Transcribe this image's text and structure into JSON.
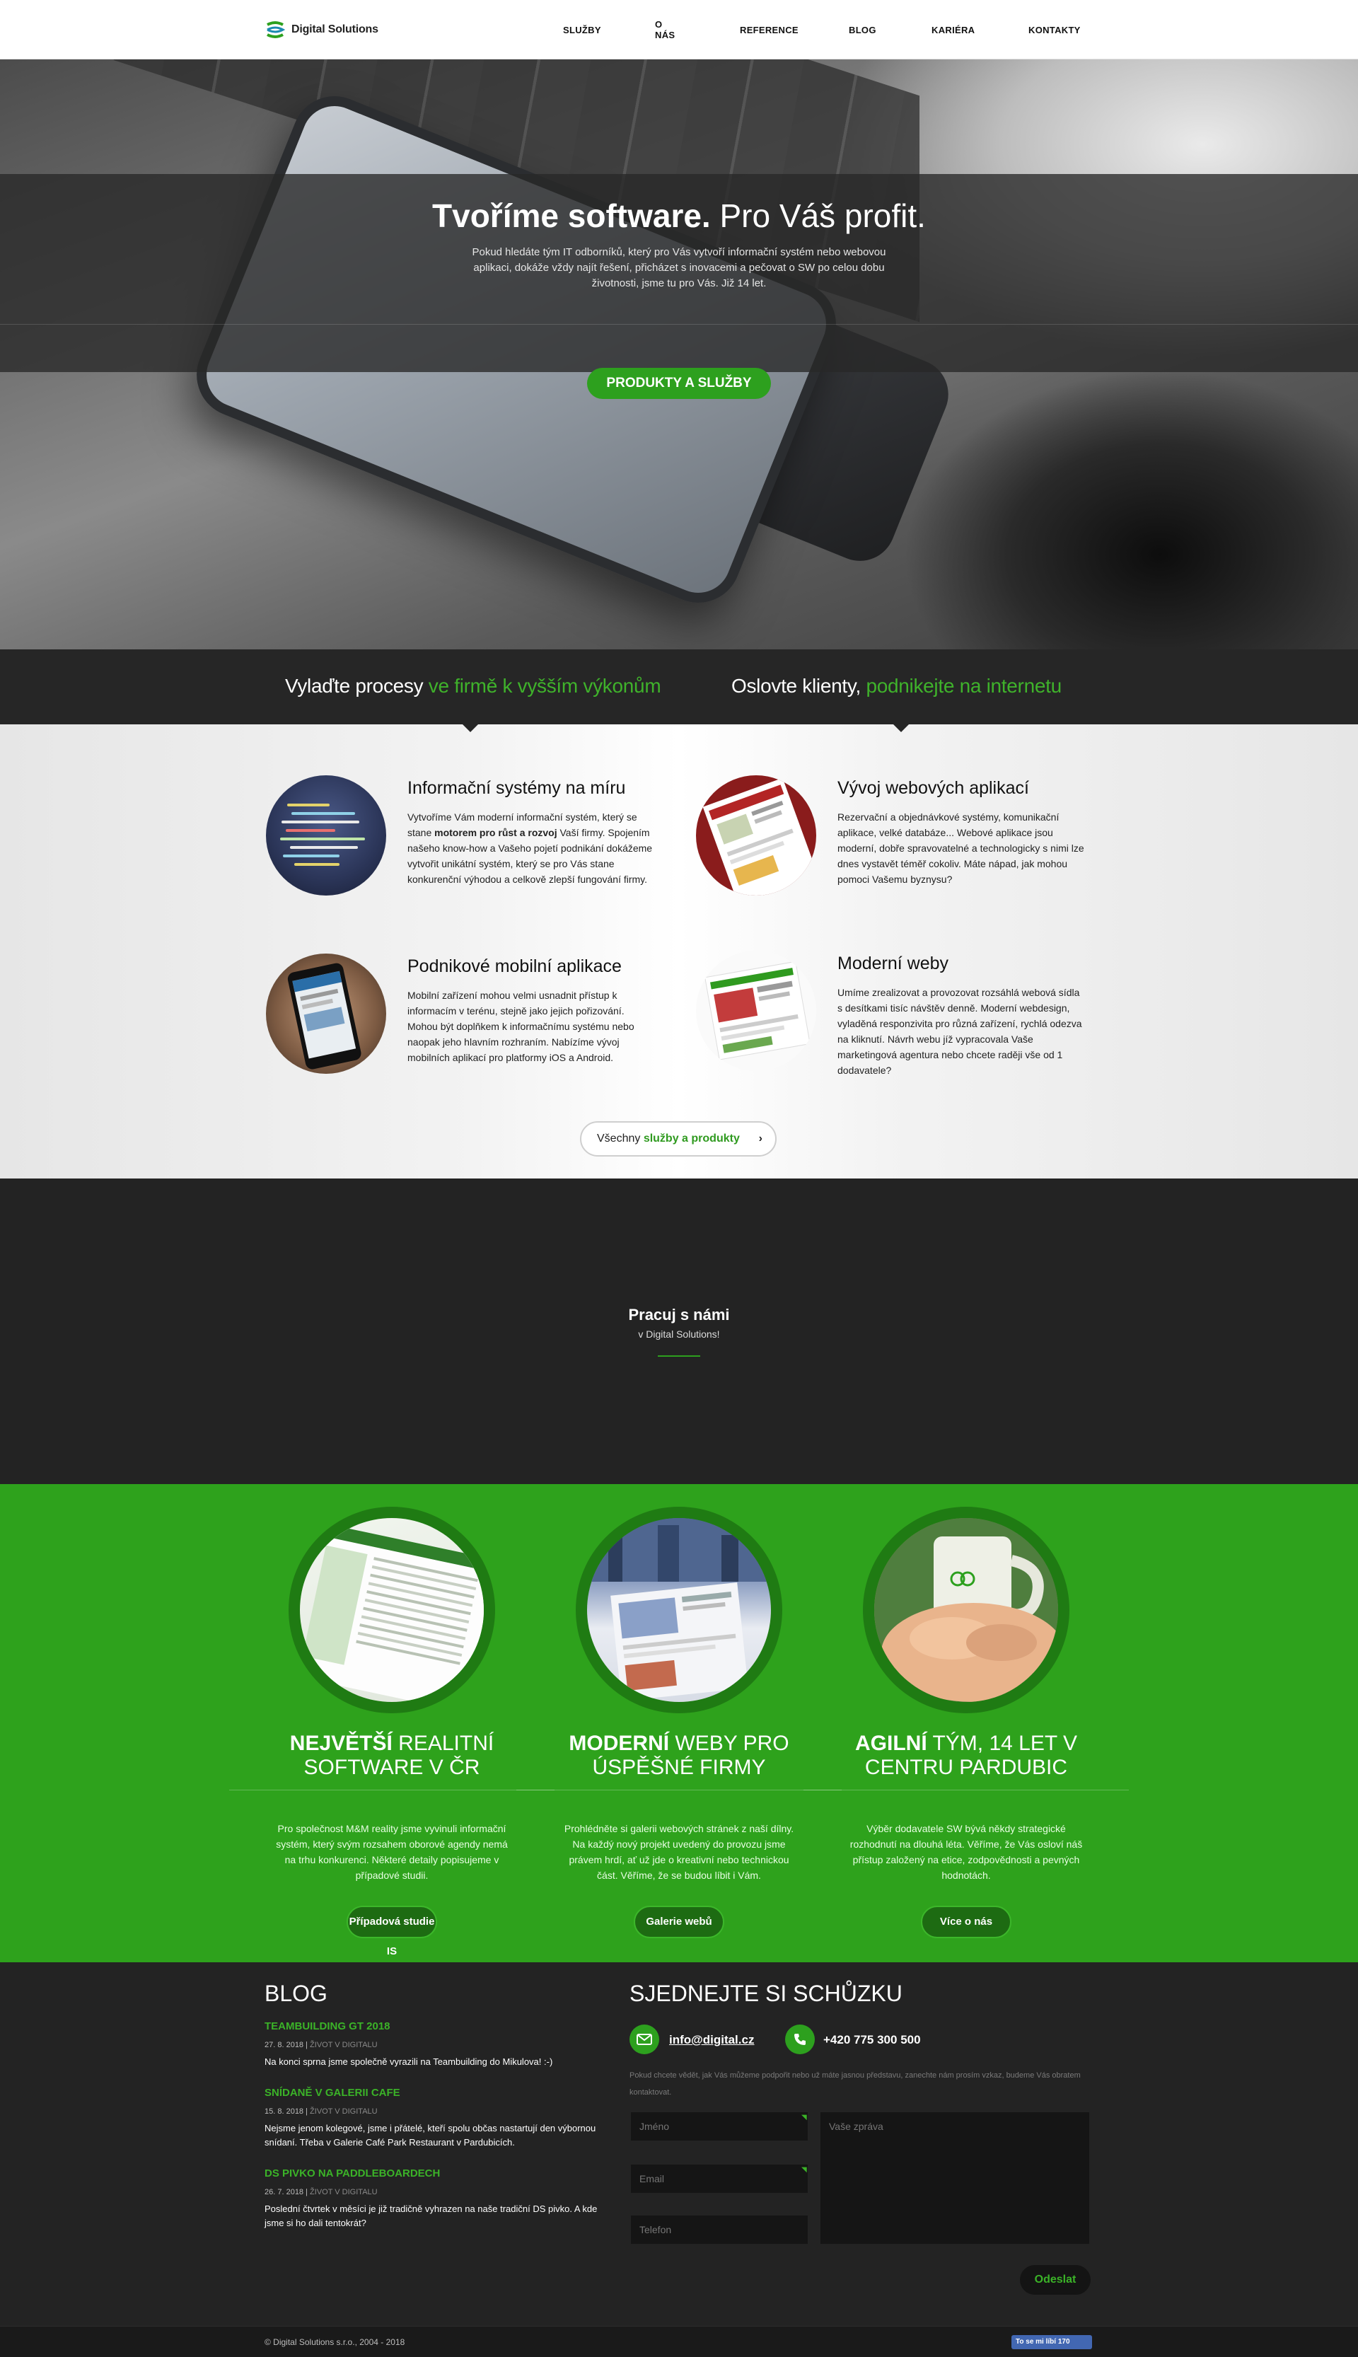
{
  "header": {
    "logo_text": "Digital Solutions",
    "nav": [
      "SLUŽBY",
      "O NÁS",
      "REFERENCE",
      "BLOG",
      "KARIÉRA",
      "KONTAKTY"
    ]
  },
  "hero": {
    "title_bold": "Tvoříme software.",
    "title_light": " Pro Váš profit.",
    "text": "Pokud hledáte tým IT odborníků, který pro Vás vytvoří informační systém nebo webovou aplikaci, dokáže vždy najít řešení, přicházet s inovacemi a pečovat o SW po celou dobu životnosti, jsme tu pro Vás. Již 14 let.",
    "button": "PRODUKTY A SLUŽBY"
  },
  "tabs": [
    {
      "white": "Vylaďte procesy ",
      "green": "ve firmě k vyšším výkonům"
    },
    {
      "white": "Oslovte klienty, ",
      "green": "podnikejte na internetu"
    }
  ],
  "services": [
    {
      "title": "Informační systémy na míru",
      "text_a": "Vytvoříme Vám moderní informační systém, který se stane ",
      "text_bold": "motorem pro růst a rozvoj",
      "text_b": " Vaší firmy. Spojením našeho know-how a Vašeho pojetí podnikání dokážeme vytvořit unikátní systém, který se pro Vás stane konkurenční výhodou a celkově zlepší fungování firmy."
    },
    {
      "title": "Vývoj webových aplikací",
      "text": "Rezervační a objednávkové systémy, komunikační aplikace, velké databáze... Webové aplikace jsou moderní, dobře spravovatelné a technologicky s nimi lze dnes vystavět téměř cokoliv. Máte nápad, jak mohou pomoci Vašemu byznysu?"
    },
    {
      "title": "Podnikové mobilní aplikace",
      "text": "Mobilní zařízení mohou velmi usnadnit přístup k informacím v terénu, stejně jako jejich pořizování. Mohou být doplňkem k informačnímu systému nebo naopak jeho hlavním rozhraním. Nabízíme vývoj mobilních aplikací pro platformy iOS a Android."
    },
    {
      "title": "Moderní weby",
      "text": "Umíme zrealizovat a provozovat rozsáhlá webová sídla s desítkami tisíc návštěv denně. Moderní webdesign, vyladěná responzivita pro různá zařízení, rychlá odezva na kliknutí. Návrh webu jíž vypracovala Vaše marketingová agentura nebo chcete raději vše od 1 dodavatele?"
    }
  ],
  "all_services": {
    "prefix": "Všechny ",
    "green": "služby a produkty",
    "chevron": "›"
  },
  "careers": {
    "title": "Pracuj s námi",
    "subtitle": "v Digital Solutions!"
  },
  "features": [
    {
      "bold": "NEJVĚTŠÍ",
      "rest": " REALITNÍ SOFTWARE V ČR",
      "text": "Pro společnost M&M reality jsme vyvinuli informační systém, který svým rozsahem oborové agendy nemá na trhu konkurenci. Některé detaily popisujeme v případové studii.",
      "button": "Případová studie IS"
    },
    {
      "bold": "MODERNÍ",
      "rest": " WEBY PRO ÚSPĚŠNÉ FIRMY",
      "text": "Prohlédněte si galerii webových stránek z naší dílny. Na každý nový projekt uvedený do provozu jsme právem hrdí, ať už jde o kreativní nebo technickou část. Věříme, že se budou líbit i Vám.",
      "button": "Galerie webů"
    },
    {
      "bold": "AGILNÍ",
      "rest": " TÝM, 14 LET V CENTRU PARDUBIC",
      "text": "Výběr dodavatele SW bývá někdy strategické rozhodnutí na dlouhá léta. Věříme, že Vás osloví náš přístup založený na etice, zodpovědnosti a pevných hodnotách.",
      "button": "Více o nás"
    }
  ],
  "blog": {
    "title": "BLOG",
    "posts": [
      {
        "title": "TEAMBUILDING GT 2018",
        "date": "27. 8. 2018",
        "sep": " | ",
        "category": "ŽIVOT V DIGITALU",
        "text": "Na konci sprna jsme společně vyrazili na Teambuilding do Mikulova! :-)"
      },
      {
        "title": "SNÍDANĚ V GALERII CAFE",
        "date": "15. 8. 2018",
        "sep": " | ",
        "category": "ŽIVOT V DIGITALU",
        "text": "Nejsme jenom kolegové, jsme i přátelé, kteří spolu občas nastartují den výbornou snídaní. Třeba v Galerie Café Park Restaurant v Pardubicích."
      },
      {
        "title": "DS PIVKO NA PADDLEBOARDECH",
        "date": "26. 7. 2018",
        "sep": " | ",
        "category": "ŽIVOT V DIGITALU",
        "text": "Poslední čtvrtek v měsíci je již tradičně vyhrazen na naše tradiční DS pivko. A kde jsme si ho dali tentokrát?"
      }
    ]
  },
  "meeting": {
    "title": "SJEDNEJTE SI SCHŮZKU",
    "email": "info@digital.cz",
    "phone": "+420 775 300 500",
    "text": "Pokud chcete vědět, jak Vás můžeme podpořit nebo už máte jasnou představu, zanechte nám prosím vzkaz, budeme Vás obratem kontaktovat.",
    "name_placeholder": "Jméno",
    "email_placeholder": "Email",
    "phone_placeholder": "Telefon",
    "message_placeholder": "Vaše zpráva",
    "send": "Odeslat"
  },
  "footer": {
    "copyright": "© Digital Solutions s.r.o., 2004 - 2018",
    "like": "To se mi líbí 170"
  },
  "colors": {
    "accent": "#2da01e",
    "dark": "#232323",
    "green_section": "#2ea21c"
  }
}
